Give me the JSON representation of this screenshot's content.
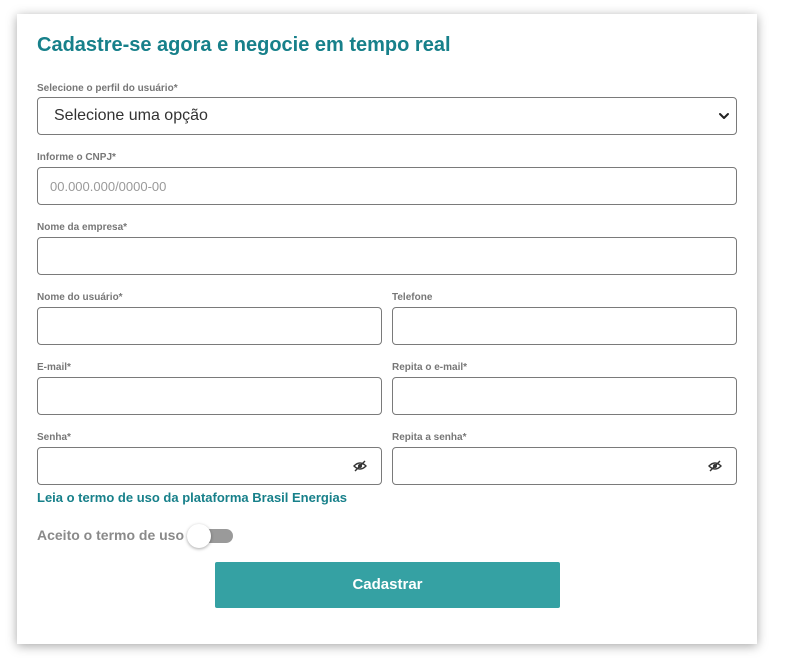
{
  "form": {
    "title": "Cadastre-se agora e negocie em tempo real",
    "profile": {
      "label": "Selecione o perfil do usuário*",
      "value": "Selecione uma opção"
    },
    "cnpj": {
      "label": "Informe o CNPJ*",
      "placeholder": "00.000.000/0000-00"
    },
    "company": {
      "label": "Nome da empresa*"
    },
    "username": {
      "label": "Nome do usuário*"
    },
    "phone": {
      "label": "Telefone"
    },
    "email": {
      "label": "E-mail*"
    },
    "email_confirm": {
      "label": "Repita o e-mail*"
    },
    "password": {
      "label": "Senha*"
    },
    "password_confirm": {
      "label": "Repita a senha*"
    },
    "terms_link": "Leia o termo de uso da plataforma Brasil Energias",
    "accept_terms": {
      "label": "Aceito o termo de uso",
      "checked": false
    },
    "submit_label": "Cadastrar"
  },
  "colors": {
    "accent": "#17808a",
    "button": "#35a1a3",
    "label": "#777777",
    "border": "#7a7a7a"
  },
  "icons": {
    "select_arrow": "chevron-down-icon",
    "password_toggle": "eye-slash-icon"
  }
}
